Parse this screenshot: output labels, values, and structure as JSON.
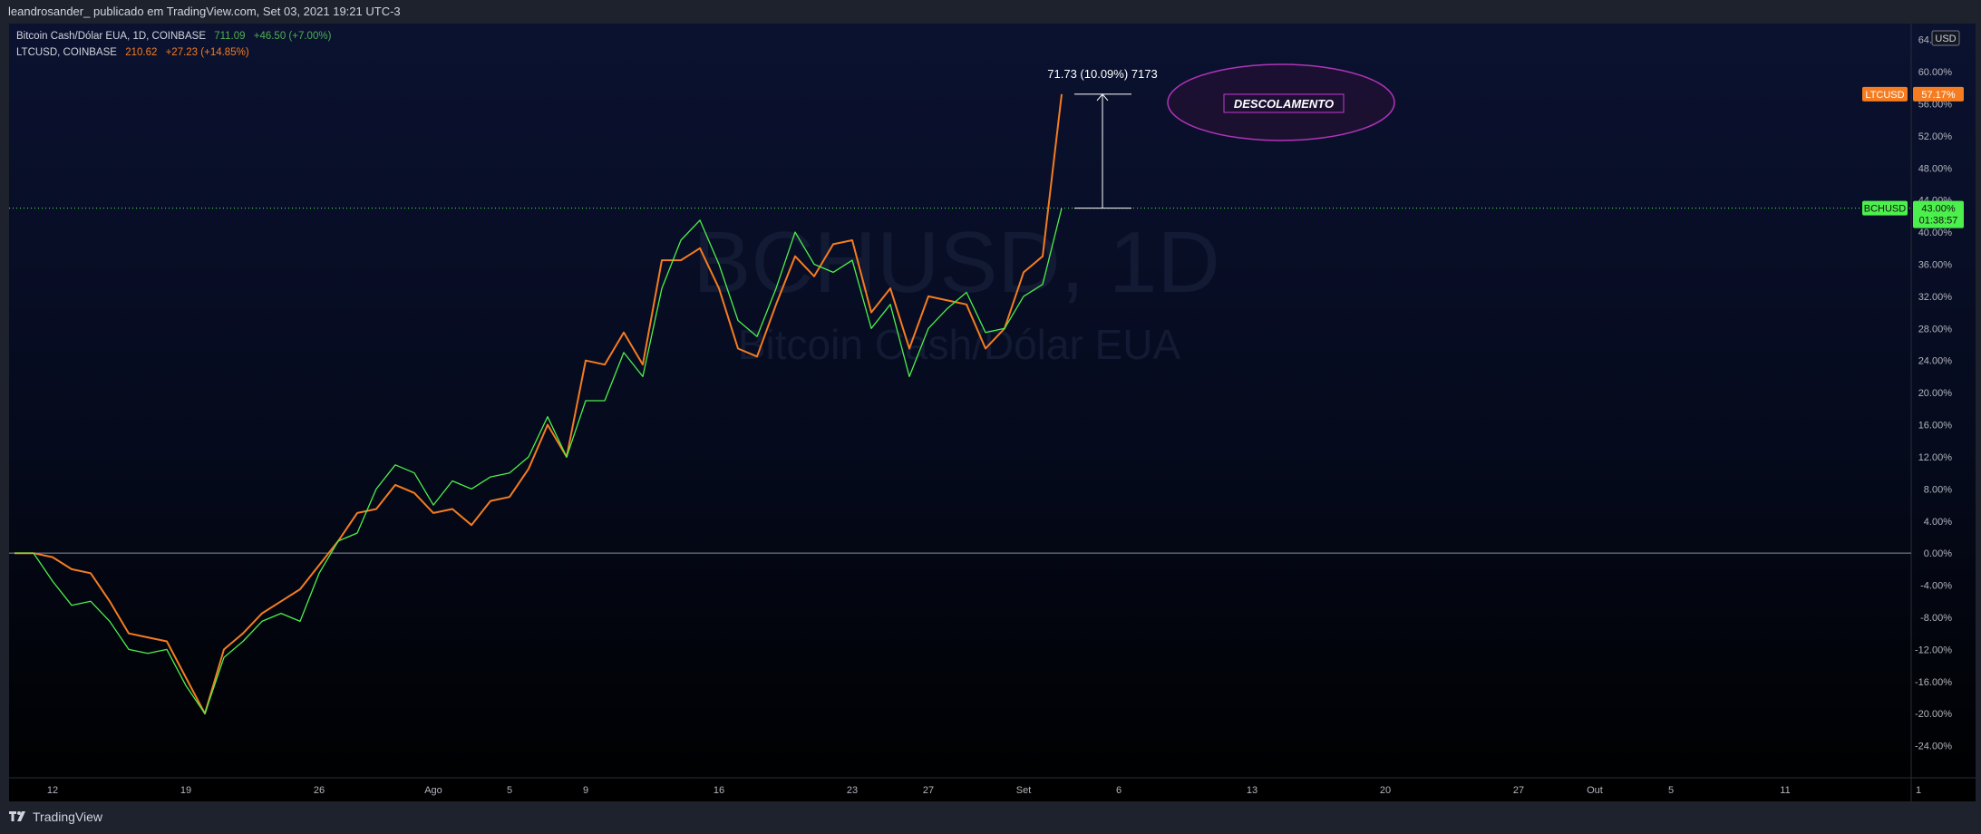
{
  "header": {
    "publish_line": "leandrosander_ publicado em TradingView.com, Set 03, 2021 19:21 UTC-3"
  },
  "legend": [
    {
      "name": "Bitcoin Cash/Dólar EUA, 1D, COINBASE",
      "price": "711.09",
      "change": "+46.50 (+7.00%)",
      "color": "#4caf50"
    },
    {
      "name": "LTCUSD, COINBASE",
      "price": "210.62",
      "change": "+27.23 (+14.85%)",
      "color": "#f57c20"
    }
  ],
  "watermark": {
    "symbol": "BCHUSD, 1D",
    "description": "Bitcoin Cash/Dólar EUA"
  },
  "currency_badge": "USD",
  "measure_label": "71.73 (10.09%) 7173",
  "annotation": {
    "text": "DESCOLAMENTO",
    "ellipse_color": "#b034b8"
  },
  "price_tags": [
    {
      "symbol": "LTCUSD",
      "value": "57.17%",
      "color": "#f57c20"
    },
    {
      "symbol": "BCHUSD",
      "value": "43.00%",
      "countdown": "01:38:57",
      "color": "#4cf04c"
    }
  ],
  "chart_data": {
    "type": "line",
    "ylim": [
      -28,
      66
    ],
    "yscale": "percent",
    "y_ticks": [
      "64.00%",
      "60.00%",
      "56.00%",
      "52.00%",
      "48.00%",
      "44.00%",
      "40.00%",
      "36.00%",
      "32.00%",
      "28.00%",
      "24.00%",
      "20.00%",
      "16.00%",
      "12.00%",
      "8.00%",
      "4.00%",
      "0.00%",
      "-4.00%",
      "-8.00%",
      "-12.00%",
      "-16.00%",
      "-20.00%",
      "-24.00%"
    ],
    "y_tick_values": [
      64,
      60,
      56,
      52,
      48,
      44,
      40,
      36,
      32,
      28,
      24,
      20,
      16,
      12,
      8,
      4,
      0,
      -4,
      -8,
      -12,
      -16,
      -20,
      -24
    ],
    "x_range": [
      0,
      100
    ],
    "x_ticks": [
      {
        "label": "12",
        "x": 2
      },
      {
        "label": "19",
        "x": 9
      },
      {
        "label": "26",
        "x": 16
      },
      {
        "label": "Ago",
        "x": 22
      },
      {
        "label": "5",
        "x": 26
      },
      {
        "label": "9",
        "x": 30
      },
      {
        "label": "16",
        "x": 37
      },
      {
        "label": "23",
        "x": 44
      },
      {
        "label": "27",
        "x": 48
      },
      {
        "label": "Set",
        "x": 53
      },
      {
        "label": "6",
        "x": 58
      },
      {
        "label": "13",
        "x": 65
      },
      {
        "label": "20",
        "x": 72
      },
      {
        "label": "27",
        "x": 79
      },
      {
        "label": "Out",
        "x": 83
      },
      {
        "label": "5",
        "x": 87
      },
      {
        "label": "11",
        "x": 93
      },
      {
        "label": "1",
        "x": 100
      }
    ],
    "series": [
      {
        "name": "LTCUSD",
        "color": "#f57c20",
        "x": [
          0,
          1,
          2,
          3,
          4,
          5,
          6,
          7,
          8,
          9,
          10,
          11,
          12,
          13,
          14,
          15,
          16,
          17,
          18,
          19,
          20,
          21,
          22,
          23,
          24,
          25,
          26,
          27,
          28,
          29,
          30,
          31,
          32,
          33,
          34,
          35,
          36,
          37,
          38,
          39,
          40,
          41,
          42,
          43,
          44,
          45,
          46,
          47,
          48,
          49,
          50,
          51,
          52,
          53,
          54,
          55
        ],
        "y": [
          0,
          0,
          -0.5,
          -2,
          -2.5,
          -6,
          -10,
          -10.5,
          -11,
          -15.5,
          -20,
          -12,
          -10,
          -7.5,
          -6,
          -4.5,
          -1.5,
          1.5,
          5,
          5.5,
          8.5,
          7.5,
          5,
          5.5,
          3.5,
          6.5,
          7,
          10.5,
          16,
          12,
          24,
          23.5,
          27.5,
          23.5,
          36.5,
          36.5,
          38,
          33,
          25.5,
          24.5,
          31,
          37,
          34.5,
          38.5,
          39,
          30,
          33,
          25.5,
          32,
          31.5,
          31,
          25.5,
          28,
          35,
          37,
          57.2
        ]
      },
      {
        "name": "BCHUSD",
        "color": "#4cf04c",
        "x": [
          0,
          1,
          2,
          3,
          4,
          5,
          6,
          7,
          8,
          9,
          10,
          11,
          12,
          13,
          14,
          15,
          16,
          17,
          18,
          19,
          20,
          21,
          22,
          23,
          24,
          25,
          26,
          27,
          28,
          29,
          30,
          31,
          32,
          33,
          34,
          35,
          36,
          37,
          38,
          39,
          40,
          41,
          42,
          43,
          44,
          45,
          46,
          47,
          48,
          49,
          50,
          51,
          52,
          53,
          54,
          55
        ],
        "y": [
          0,
          0,
          -3.5,
          -6.5,
          -6,
          -8.5,
          -12,
          -12.5,
          -12,
          -16.5,
          -20,
          -13,
          -11,
          -8.5,
          -7.5,
          -8.5,
          -2.5,
          1.5,
          2.5,
          8,
          11,
          10,
          6,
          9,
          8,
          9.5,
          10,
          12,
          17,
          12,
          19,
          19,
          25,
          22,
          33,
          39,
          41.5,
          36,
          29,
          27,
          33,
          40,
          36,
          35,
          36.5,
          28,
          31,
          22,
          28,
          30.5,
          32.5,
          27.5,
          28,
          32,
          33.5,
          43
        ]
      }
    ]
  }
}
